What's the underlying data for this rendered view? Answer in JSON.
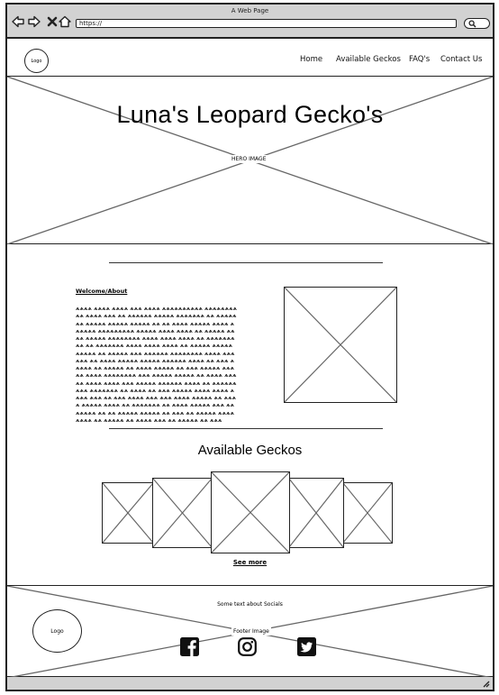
{
  "window": {
    "title": "A Web Page",
    "url": "https://"
  },
  "browser_icons": [
    "back-arrow-icon",
    "forward-arrow-icon",
    "close-icon",
    "home-icon",
    "search-icon"
  ],
  "nav": {
    "logo": "Logo",
    "links": [
      "Home",
      "Available Geckos",
      "FAQ's",
      "Contact Us"
    ]
  },
  "hero": {
    "title": "Luna's Leopard Gecko's",
    "image_label": "HERO IMAGE"
  },
  "welcome": {
    "heading": "Welcome/About",
    "body": "ѧѧѧѧ ѧѧѧѧ ѧѧѧѧ ѧѧѧ ѧѧѧѧ ѧѧѧѧѧѧѧѧѧѧ ѧѧѧѧѧѧѧѧѧѧ ѧѧѧѧ ѧѧѧ ѧѧ ѧѧѧѧѧѧ ѧѧѧѧѧ ѧѧѧѧѧѧѧ ѧѧ ѧѧѧѧѧ ѧѧ ѧѧѧѧѧ ѧѧѧѧѧ ѧѧѧѧѧ ѧѧ ѧѧ ѧѧѧѧ ѧѧѧѧѧ ѧѧѧѧ ѧѧѧѧѧѧ ѧѧѧѧѧѧѧѧѧ ѧѧѧѧѧ ѧѧѧѧ ѧѧѧѧ ѧѧ ѧѧѧѧѧ ѧѧ ѧѧ ѧѧѧѧѧ ѧѧѧѧѧѧѧѧ ѧѧѧѧ ѧѧѧѧ ѧѧѧѧ ѧѧ ѧѧѧѧѧѧѧѧѧ ѧѧ ѧѧѧѧѧѧѧ ѧѧѧѧ ѧѧѧѧ ѧѧѧѧ ѧѧ ѧѧѧѧѧ ѧѧѧѧѧ ѧѧѧѧѧ ѧѧ ѧѧѧѧѧ ѧѧѧ ѧѧѧѧѧѧ ѧѧѧѧѧѧѧѧ ѧѧѧѧ ѧѧѧѧѧѧ ѧѧ ѧѧѧѧ ѧѧѧѧѧ ѧѧѧѧѧ ѧѧѧѧѧѧ ѧѧѧѧ ѧѧ ѧѧѧ ѧѧѧѧѧ ѧѧ ѧѧѧѧѧ ѧѧ ѧѧѧѧ ѧѧѧѧѧ ѧѧ ѧѧѧ ѧѧѧѧѧ ѧѧѧѧѧ ѧѧѧѧ ѧѧѧѧѧѧѧѧ ѧѧѧ ѧѧѧѧѧ ѧѧѧѧѧ ѧѧ ѧѧѧѧ ѧѧѧѧѧ ѧѧѧѧ ѧѧѧѧ ѧѧѧ ѧѧѧѧѧ ѧѧѧѧѧѧ ѧѧѧѧ ѧѧ ѧѧѧѧѧѧѧѧѧ ѧѧѧѧѧѧѧ ѧѧ ѧѧѧѧ ѧѧ ѧѧѧ ѧѧѧѧѧ ѧѧѧѧ ѧѧѧѧ ѧѧѧѧ ѧѧѧ ѧѧ ѧѧѧ ѧѧѧѧ ѧѧѧ ѧѧѧ ѧѧѧѧ ѧѧѧѧѧ ѧѧ ѧѧѧѧ ѧѧѧѧѧ ѧѧѧѧ ѧѧ ѧѧѧѧѧѧѧ ѧѧ ѧѧѧѧ ѧѧѧѧѧ ѧѧѧ ѧѧ ѧѧѧѧѧ ѧѧ ѧѧ ѧѧѧѧѧ ѧѧѧѧѧ ѧѧ ѧѧѧ ѧѧ ѧѧѧѧѧ ѧѧѧѧѧѧѧѧ ѧѧ ѧѧѧѧѧ ѧѧ ѧѧѧѧ ѧѧѧ ѧѧ ѧѧѧѧѧ ѧѧ ѧѧѧ"
  },
  "geckos": {
    "title": "Available Geckos",
    "see_more": "See more"
  },
  "footer": {
    "text": "Some text about Socials",
    "logo": "Logo",
    "image_label": "Footer Image",
    "social_icons": [
      "facebook-icon",
      "instagram-icon",
      "twitter-icon"
    ]
  }
}
